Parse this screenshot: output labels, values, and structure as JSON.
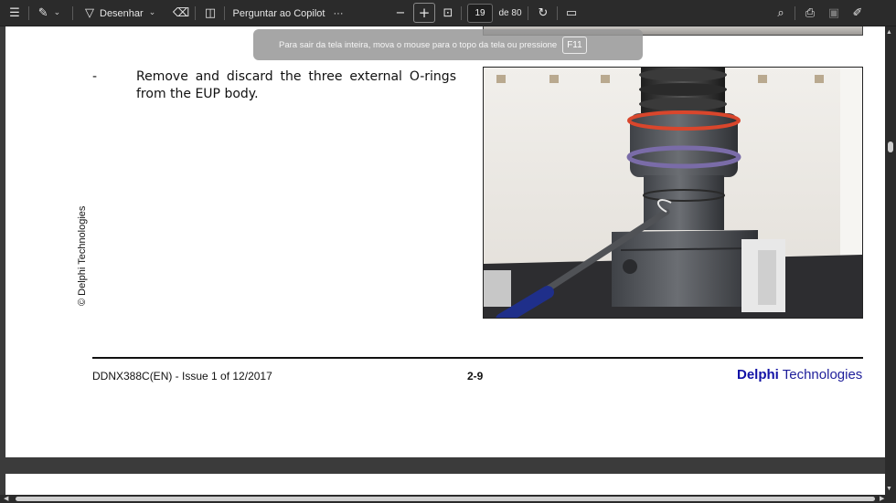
{
  "toolbar": {
    "draw_label": "Desenhar",
    "copilot_label": "Perguntar ao Copilot",
    "more_label": "···",
    "zoom_out": "−",
    "zoom_in": "+",
    "page_number": "19",
    "page_total": "de 80",
    "icons": [
      "contents-icon",
      "highlight-icon",
      "draw-icon",
      "eraser-icon",
      "text-box-icon",
      "fit-page-icon",
      "rotate-icon",
      "two-page-icon",
      "search-icon",
      "print-icon",
      "save-icon",
      "save-as-icon"
    ]
  },
  "toast": {
    "message": "Para sair da tela inteira, mova o mouse para o topo da tela ou pressione",
    "key": "F11"
  },
  "document": {
    "bullet": "-",
    "instruction": "Remove and discard the three external O-rings from the EUP body.",
    "copyright": "© Delphi Technologies",
    "footer_left": "DDNX388C(EN) - Issue 1 of 12/2017",
    "footer_page": "2-9",
    "brand_bold": "Delphi",
    "brand_rest": " Technologies"
  }
}
